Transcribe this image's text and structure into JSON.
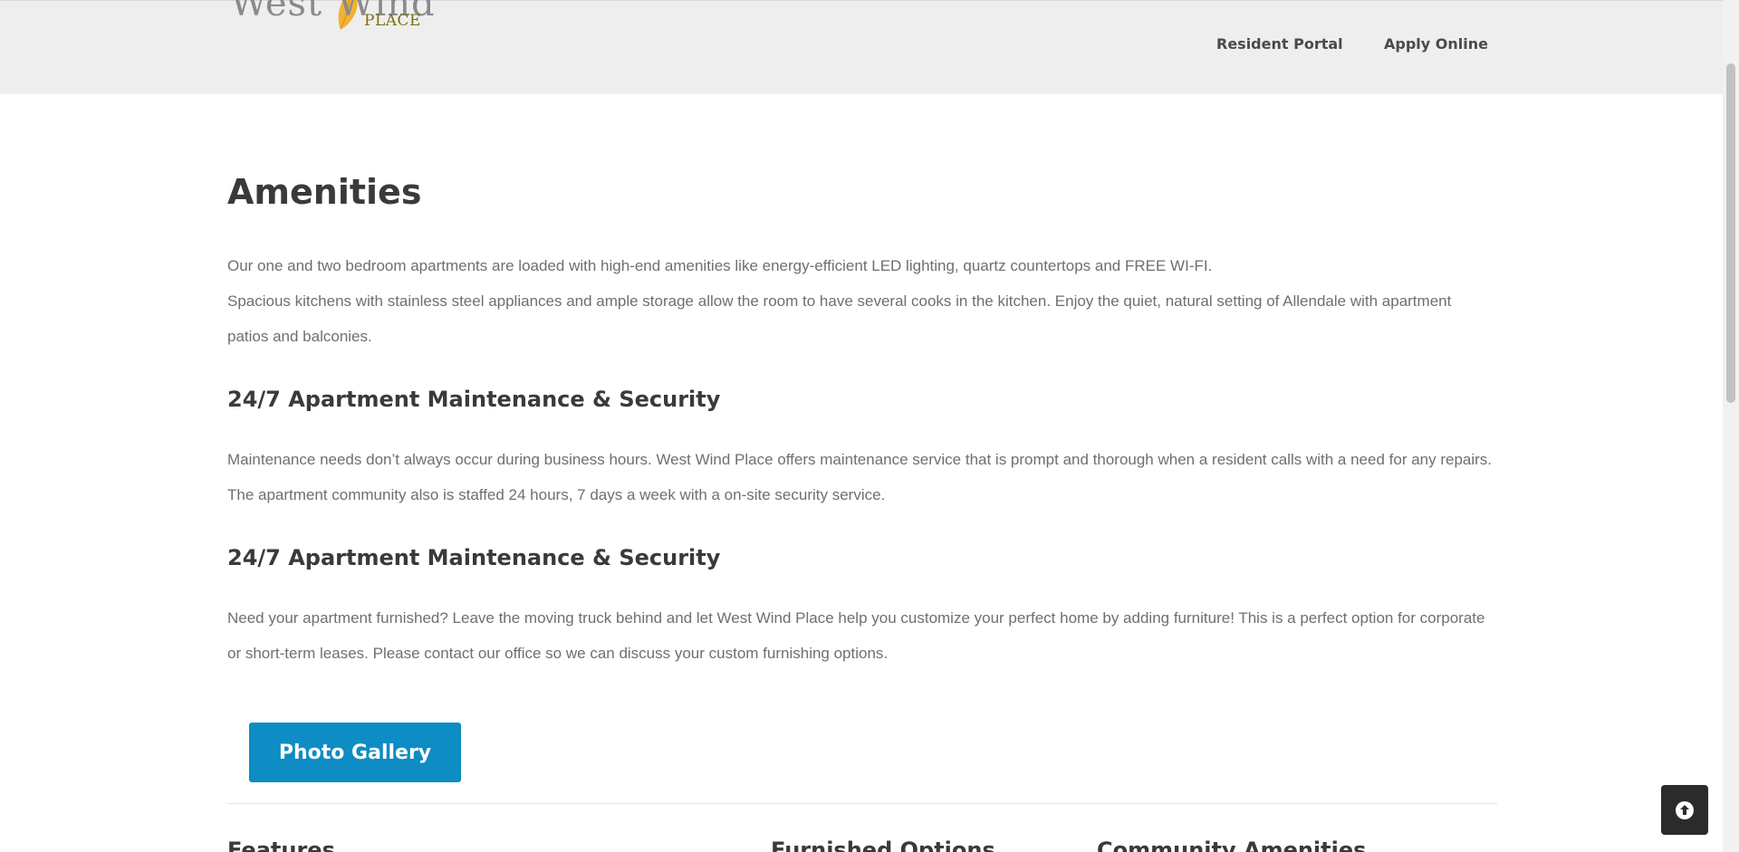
{
  "header": {
    "logo": {
      "word1": "West",
      "word2": "Wind",
      "word3": "PLACE"
    },
    "nav": [
      {
        "label": "Resident Portal"
      },
      {
        "label": "Apply Online"
      }
    ]
  },
  "main": {
    "title": "Amenities",
    "intro_line1": "Our one and two bedroom apartments are loaded with high-end amenities like energy-efficient LED lighting, quartz countertops and FREE WI-FI.",
    "intro_line2": "Spacious kitchens with stainless steel appliances and ample storage allow the room to have several cooks in the kitchen. Enjoy the quiet, natural setting of Allendale with apartment patios and balconies.",
    "sections": [
      {
        "heading": "24/7 Apartment Maintenance & Security",
        "body": "Maintenance needs don’t always occur during business hours. West Wind Place offers maintenance service that is prompt and thorough when a resident calls with a need for any repairs. The apartment community also is staffed 24 hours, 7 days a week with a on-site security service."
      },
      {
        "heading": "24/7 Apartment Maintenance & Security",
        "body": "Need your apartment furnished? Leave the moving truck behind and let West Wind Place help you customize your perfect home by adding furniture! This is a perfect option for corporate or short-term leases. Please contact our office so we can discuss your custom furnishing options."
      }
    ],
    "gallery_button": "Photo Gallery"
  },
  "footer": {
    "columns": [
      {
        "title": "Features"
      },
      {
        "title": "Furnished Options"
      },
      {
        "title": "Community Amenities"
      }
    ]
  },
  "icons": {
    "scroll_top": "arrow-circle-up-icon",
    "logo_leaf": "leaf-icon"
  },
  "colors": {
    "header_bg": "#eeeeee",
    "button_bg": "#0e8cc4",
    "logo_leaf": "#f2b134",
    "logo_place": "#7a6f12",
    "scroll_top_bg": "#2b2b2b"
  }
}
